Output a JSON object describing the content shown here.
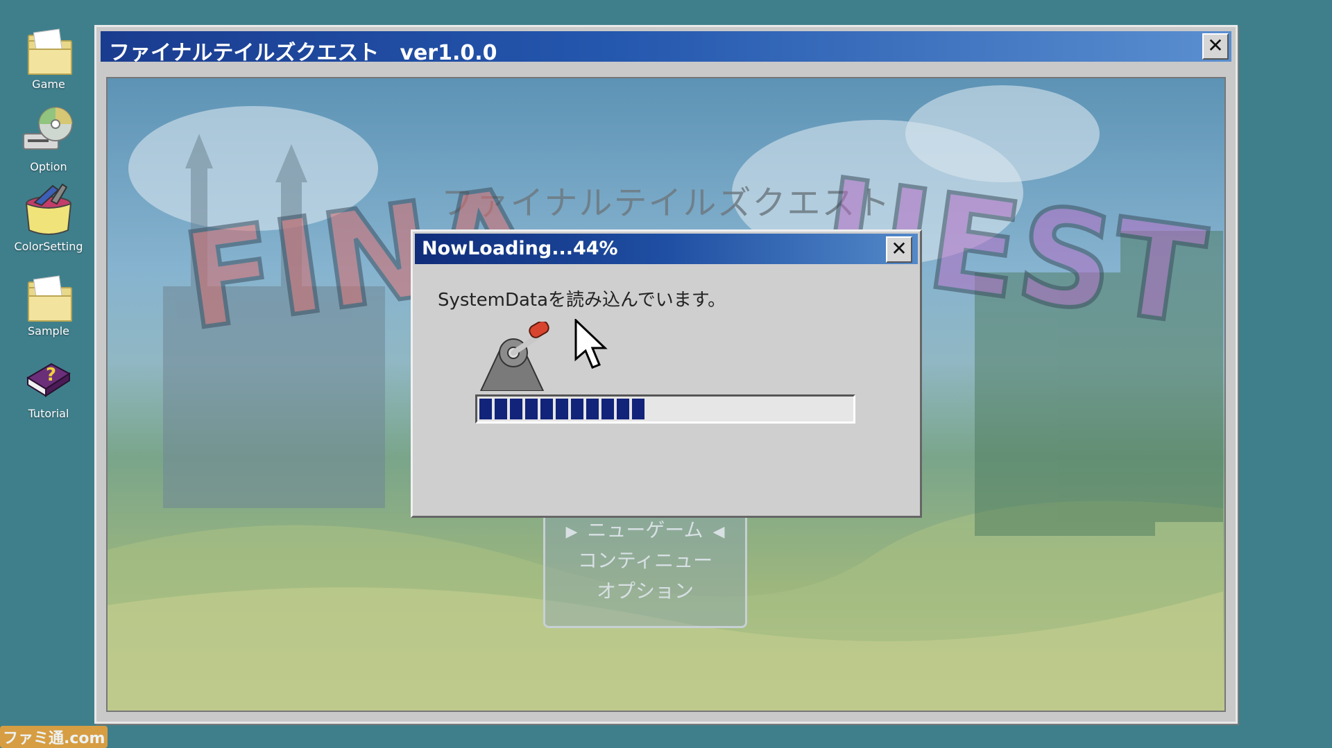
{
  "desktop": {
    "icons": [
      {
        "label": "Game",
        "icon": "folder-icon"
      },
      {
        "label": "Option",
        "icon": "cd-drive-icon"
      },
      {
        "label": "ColorSetting",
        "icon": "paint-bucket-icon"
      },
      {
        "label": "Sample",
        "icon": "folder-icon"
      },
      {
        "label": "Tutorial",
        "icon": "help-book-icon"
      }
    ]
  },
  "main_window": {
    "title": "ファイナルテイルズクエスト　ver1.0.0",
    "close_glyph": "✕"
  },
  "game_screen": {
    "title_jp": "ファイナルテイルズクエスト",
    "logo_left": "FINA",
    "logo_right": "UEST",
    "menu": {
      "items": [
        "ニューゲーム",
        "コンティニュー",
        "オプション"
      ],
      "selected_index": 0
    }
  },
  "dialog": {
    "title": "NowLoading...44%",
    "close_glyph": "✕",
    "message": "SystemDataを読み込んでいます。",
    "progress_percent": 44
  },
  "watermark": "ファミ通.com",
  "colors": {
    "desktop_bg": "#3f7f8c",
    "titlebar_start": "#1a3c8f",
    "progress_fill": "#12237a"
  }
}
